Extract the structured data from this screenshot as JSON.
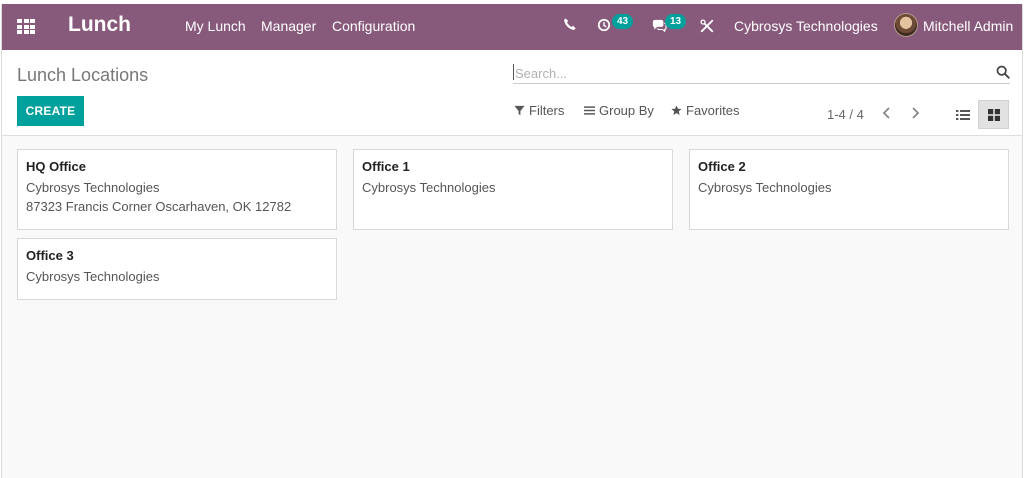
{
  "navbar": {
    "app_name": "Lunch",
    "menu": [
      "My Lunch",
      "Manager",
      "Configuration"
    ],
    "activity_count": "43",
    "message_count": "13",
    "company": "Cybrosys Technologies",
    "user": "Mitchell Admin",
    "bg_color": "#875a7b"
  },
  "control_panel": {
    "title": "Lunch Locations",
    "search_placeholder": "Search...",
    "create_label": "CREATE",
    "filters_label": "Filters",
    "groupby_label": "Group By",
    "favorites_label": "Favorites",
    "pager": "1-4 / 4",
    "accent_color": "#00a09d"
  },
  "locations": [
    {
      "name": "HQ Office",
      "company": "Cybrosys Technologies",
      "address": "87323 Francis Corner Oscarhaven, OK 12782"
    },
    {
      "name": "Office 1",
      "company": "Cybrosys Technologies"
    },
    {
      "name": "Office 2",
      "company": "Cybrosys Technologies"
    },
    {
      "name": "Office 3",
      "company": "Cybrosys Technologies"
    }
  ],
  "icons": {
    "apps": "grid-icon",
    "phone": "phone-icon",
    "activity": "clock-icon",
    "messages": "chat-icon",
    "tools": "tools-icon",
    "search": "search-icon",
    "filter": "funnel-icon",
    "groupby": "bars-icon",
    "favorites": "star-icon",
    "prev": "chevron-left-icon",
    "next": "chevron-right-icon",
    "list_view": "list-view-icon",
    "kanban_view": "kanban-view-icon"
  }
}
